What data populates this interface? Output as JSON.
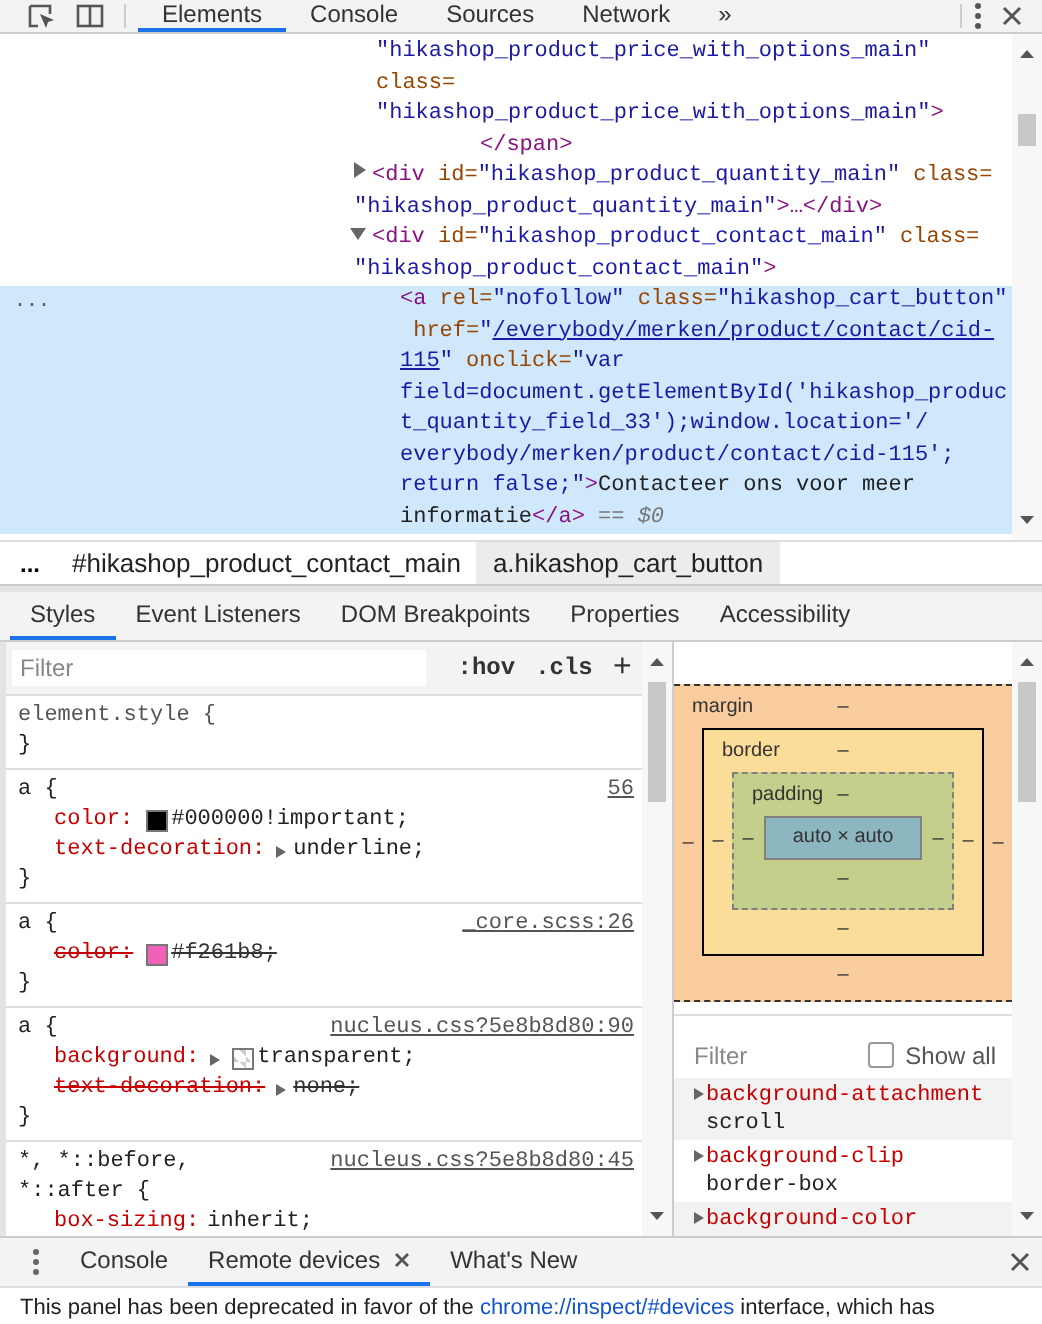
{
  "toolbar": {
    "tabs": [
      {
        "label": "Elements",
        "selected": true
      },
      {
        "label": "Console",
        "selected": false
      },
      {
        "label": "Sources",
        "selected": false
      },
      {
        "label": "Network",
        "selected": false
      }
    ],
    "more": "»"
  },
  "dom_tree": {
    "rows": [
      {
        "kind": "attrs",
        "selected": false,
        "lines": [
          [
            {
              "kind": "value",
              "text": "\"hikashop_product_price_with_options_main\""
            }
          ],
          [
            {
              "kind": "attr",
              "text": "class="
            }
          ],
          [
            {
              "kind": "value",
              "text": "\"hikashop_product_price_with_options_main\""
            },
            {
              "kind": "tag",
              "text": ">"
            }
          ]
        ]
      },
      {
        "kind": "closing",
        "selected": false,
        "lines": [
          [
            {
              "kind": "tag",
              "text": "</span>"
            }
          ]
        ]
      },
      {
        "kind": "element",
        "selected": false,
        "expanded": false,
        "lines": [
          [
            {
              "kind": "tag",
              "text": "<div"
            },
            {
              "kind": "attr",
              "text": " id="
            },
            {
              "kind": "value",
              "text": "\"hikashop_product_quantity_main\""
            },
            {
              "kind": "attr",
              "text": " class="
            }
          ],
          [
            {
              "kind": "value",
              "text": "\"hikashop_product_quantity_main\""
            },
            {
              "kind": "tag",
              "text": ">…</div>"
            }
          ]
        ]
      },
      {
        "kind": "element",
        "selected": false,
        "expanded": true,
        "lines": [
          [
            {
              "kind": "tag",
              "text": "<div"
            },
            {
              "kind": "attr",
              "text": " id="
            },
            {
              "kind": "value",
              "text": "\"hikashop_product_contact_main\""
            },
            {
              "kind": "attr",
              "text": " class="
            }
          ],
          [
            {
              "kind": "value",
              "text": "\"hikashop_product_contact_main\""
            },
            {
              "kind": "tag",
              "text": ">"
            }
          ]
        ]
      },
      {
        "kind": "child",
        "selected": true,
        "menu": "...",
        "lines": [
          [
            {
              "kind": "tag",
              "text": "<a"
            },
            {
              "kind": "attr",
              "text": " rel="
            },
            {
              "kind": "value",
              "text": "\"nofollow\""
            },
            {
              "kind": "attr",
              "text": " class="
            },
            {
              "kind": "value",
              "text": "\"hikashop_cart_button\""
            }
          ],
          [
            {
              "kind": "attr",
              "text": " href="
            },
            {
              "kind": "value",
              "text": "\""
            },
            {
              "kind": "link",
              "text": "/everybody/merken/product/contact/cid-"
            }
          ],
          [
            {
              "kind": "link",
              "text": "115"
            },
            {
              "kind": "value",
              "text": "\""
            },
            {
              "kind": "attr",
              "text": " onclick="
            },
            {
              "kind": "value",
              "text": "\"var"
            }
          ],
          [
            {
              "kind": "value",
              "text": "field=document.getElementById('hikashop_produc"
            }
          ],
          [
            {
              "kind": "value",
              "text": "t_quantity_field_33');window.location='/"
            }
          ],
          [
            {
              "kind": "value",
              "text": "everybody/merken/product/contact/cid-115';"
            }
          ],
          [
            {
              "kind": "value",
              "text": "return false;\""
            },
            {
              "kind": "tag",
              "text": ">"
            },
            {
              "kind": "text",
              "text": "Contacteer ons voor meer"
            }
          ],
          [
            {
              "kind": "text",
              "text": "informatie"
            },
            {
              "kind": "tag",
              "text": "</a>"
            },
            {
              "kind": "hint",
              "text": " == $0"
            }
          ]
        ]
      }
    ]
  },
  "breadcrumbs": {
    "overflow": "...",
    "items": [
      {
        "label": "#hikashop_product_contact_main",
        "selected": false
      },
      {
        "label": "a.hikashop_cart_button",
        "selected": true
      }
    ]
  },
  "styles_tabs": [
    {
      "label": "Styles",
      "selected": true
    },
    {
      "label": "Event Listeners",
      "selected": false
    },
    {
      "label": "DOM Breakpoints",
      "selected": false
    },
    {
      "label": "Properties",
      "selected": false
    },
    {
      "label": "Accessibility",
      "selected": false
    }
  ],
  "styles_pane": {
    "filter": {
      "placeholder": "Filter"
    },
    "hov": ":hov",
    "cls": ".cls",
    "add": "+",
    "rules": [
      {
        "selector": "element.style {",
        "close": "}"
      },
      {
        "selector": "a {",
        "source": "56",
        "declarations": [
          {
            "property": "color:",
            "swatch": {
              "kind": "color",
              "color": "#000000"
            },
            "value": "#000000!important;",
            "expandable": false,
            "overridden": false
          },
          {
            "property": "text-decoration:",
            "value": "underline;",
            "expandable": true,
            "overridden": false
          }
        ],
        "close": "}"
      },
      {
        "selector": "a {",
        "source": "_core.scss:26",
        "declarations": [
          {
            "property": "color:",
            "swatch": {
              "kind": "color",
              "color": "#f261b8"
            },
            "value": "#f261b8;",
            "expandable": false,
            "overridden": true
          }
        ],
        "close": "}"
      },
      {
        "selector": "a {",
        "source": "nucleus.css?5e8b8d80:90",
        "declarations": [
          {
            "property": "background:",
            "swatch": {
              "kind": "transparent"
            },
            "value": "transparent;",
            "expandable": true,
            "overridden": false
          },
          {
            "property": "text-decoration:",
            "value": "none;",
            "expandable": true,
            "overridden": true
          }
        ],
        "close": "}"
      },
      {
        "selector": "*, *::before, *::after {",
        "source": "nucleus.css?5e8b8d80:45",
        "declarations": [
          {
            "property": "box-sizing:",
            "value": "inherit;",
            "expandable": false,
            "overridden": false
          }
        ]
      }
    ]
  },
  "box_model": {
    "layers": [
      {
        "kind": "margin",
        "label": "margin",
        "top": "–"
      },
      {
        "kind": "border",
        "label": "border",
        "top": "–"
      },
      {
        "kind": "padding",
        "label": "padding",
        "top": "–"
      }
    ],
    "left_values": [
      "–",
      "–",
      "–"
    ],
    "content": "auto × auto",
    "right_values": [
      "–",
      "–",
      "–"
    ],
    "bottom_values": [
      "–",
      "–",
      "–"
    ]
  },
  "computed": {
    "filter": {
      "placeholder": "Filter"
    },
    "show_all": {
      "label": "Show all",
      "checked": false
    },
    "properties": [
      {
        "property": "background-attachment",
        "value": "scroll"
      },
      {
        "property": "background-clip",
        "value": "border-box"
      },
      {
        "property": "background-color"
      }
    ]
  },
  "drawer": {
    "tabs": [
      {
        "label": "Console",
        "selected": false,
        "closable": false
      },
      {
        "label": "Remote devices",
        "selected": true,
        "closable": true
      },
      {
        "label": "What's New",
        "selected": false,
        "closable": false
      }
    ]
  },
  "message": {
    "before": "This panel has been deprecated in favor of the ",
    "link": "chrome://inspect/#devices",
    "after": " interface, which has"
  }
}
